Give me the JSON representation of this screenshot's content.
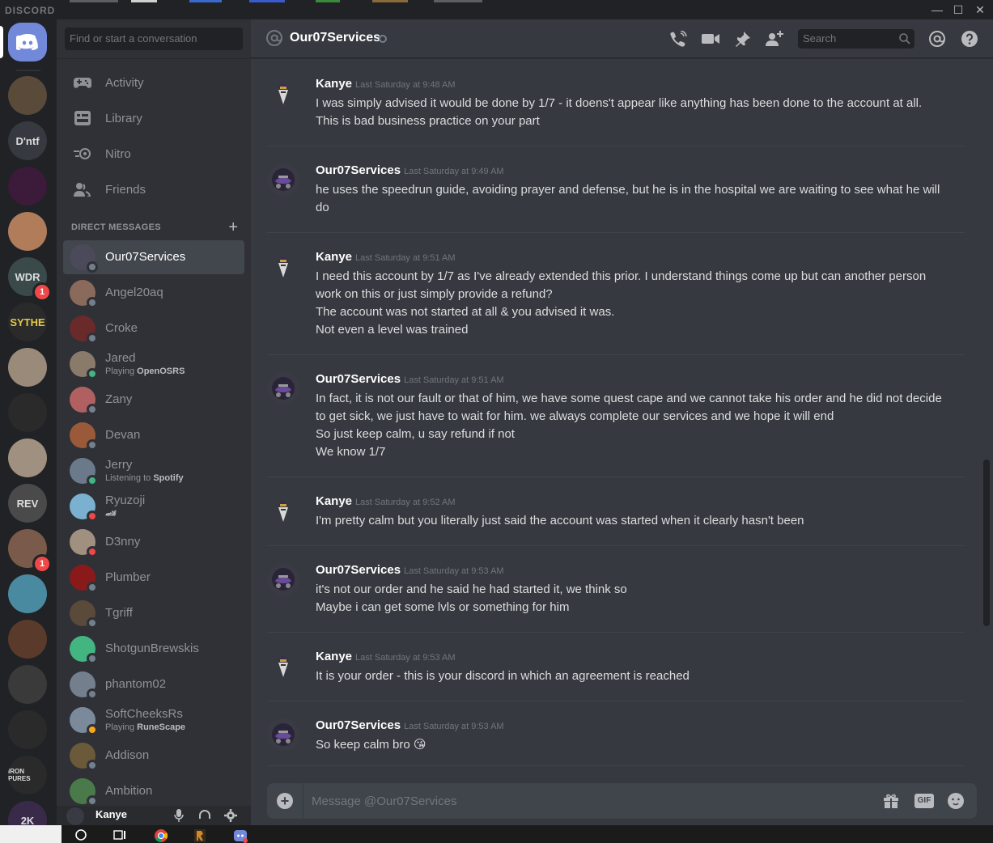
{
  "window": {
    "brand": "DISCORD",
    "minimize_glyph": "—",
    "maximize_glyph": "☐",
    "close_glyph": "✕"
  },
  "servers": {
    "items": [
      {
        "label": "",
        "kind": "home"
      },
      {
        "label": "",
        "color": "#5a4a3a"
      },
      {
        "label": "D'ntf",
        "color": "#36393f"
      },
      {
        "label": "",
        "color": "#3b1a3a"
      },
      {
        "label": "",
        "color": "#b07c5a"
      },
      {
        "label": "WDR",
        "color": "#3a4a4a",
        "badge": "1"
      },
      {
        "label": "SYTHE",
        "color": "#2a2a2a"
      },
      {
        "label": "",
        "color": "#9a8a7a"
      },
      {
        "label": "",
        "color": "#2a2a2a"
      },
      {
        "label": "",
        "color": "#a09080"
      },
      {
        "label": "REV",
        "color": "#4a4a4a"
      },
      {
        "label": "",
        "color": "#7a5a4a",
        "badge": "1"
      },
      {
        "label": "",
        "color": "#4a8aa0"
      },
      {
        "label": "",
        "color": "#5a3a2a"
      },
      {
        "label": "",
        "color": "#3a3a3a"
      },
      {
        "label": "",
        "color": "#2a2a2a"
      },
      {
        "label": "IRON PURES",
        "color": "#2a2a2a"
      },
      {
        "label": "2K",
        "color": "#3a2a4a"
      }
    ]
  },
  "sidebar": {
    "search_placeholder": "Find or start a conversation",
    "nav": [
      {
        "label": "Activity",
        "icon": "gamepad-icon"
      },
      {
        "label": "Library",
        "icon": "library-icon"
      },
      {
        "label": "Nitro",
        "icon": "nitro-icon"
      },
      {
        "label": "Friends",
        "icon": "friends-icon"
      }
    ],
    "dm_header": "DIRECT MESSAGES",
    "dm_add": "+",
    "dms": [
      {
        "name": "Our07Services",
        "status": "offline",
        "color": "#4a4a5a",
        "active": true
      },
      {
        "name": "Angel20aq",
        "status": "offline",
        "color": "#8a6a5a"
      },
      {
        "name": "Croke",
        "status": "offline",
        "color": "#6a2a2a"
      },
      {
        "name": "Jared",
        "status": "online",
        "color": "#8a7a6a",
        "activity_prefix": "Playing ",
        "activity": "OpenOSRS"
      },
      {
        "name": "Zany",
        "status": "offline",
        "color": "#b06060"
      },
      {
        "name": "Devan",
        "status": "offline",
        "color": "#9a5a3a"
      },
      {
        "name": "Jerry",
        "status": "online",
        "color": "#6a7a8a",
        "activity_prefix": "Listening to ",
        "activity": "Spotify"
      },
      {
        "name": "Ryuzoji",
        "status": "dnd",
        "color": "#7ab0d0",
        "activity_prefix": "",
        "activity": "🏎"
      },
      {
        "name": "D3nny",
        "status": "dnd",
        "color": "#a09080"
      },
      {
        "name": "Plumber",
        "status": "offline",
        "color": "#8a1a1a"
      },
      {
        "name": "Tgriff",
        "status": "offline",
        "color": "#5a4a3a"
      },
      {
        "name": "ShotgunBrewskis",
        "status": "offline",
        "color": "#43b581"
      },
      {
        "name": "phantom02",
        "status": "offline",
        "color": "#747f8d"
      },
      {
        "name": "SoftCheeksRs",
        "status": "idle",
        "color": "#7a8a9a",
        "activity_prefix": "Playing ",
        "activity": "RuneScape"
      },
      {
        "name": "Addison",
        "status": "offline",
        "color": "#6a5a3a"
      },
      {
        "name": "Ambition",
        "status": "offline",
        "color": "#4a7a4a"
      }
    ],
    "user": {
      "name": "Kanye"
    }
  },
  "chat": {
    "channel_name": "Our07Services",
    "search_placeholder": "Search",
    "composer_placeholder": "Message @Our07Services",
    "gif_label": "GIF",
    "messages": [
      {
        "author": "Kanye",
        "timestamp": "Last Saturday at 9:48 AM",
        "avatar": "kanye",
        "lines": [
          "I was simply advised it would be done by 1/7 - it doens't appear like anything has been done to the account at all.",
          "This is bad business practice on your part"
        ]
      },
      {
        "author": "Our07Services",
        "timestamp": "Last Saturday at 9:49 AM",
        "avatar": "our07",
        "lines": [
          "he uses the speedrun guide, avoiding prayer and defense, but he is in the hospital we are waiting to see what he will do"
        ]
      },
      {
        "author": "Kanye",
        "timestamp": "Last Saturday at 9:51 AM",
        "avatar": "kanye",
        "lines": [
          "I need this account by 1/7 as I've already extended this prior. I understand things come up but can another person work on this or just simply provide a refund?",
          "The account was not started at all & you advised it was.",
          "Not even a level was trained"
        ]
      },
      {
        "author": "Our07Services",
        "timestamp": "Last Saturday at 9:51 AM",
        "avatar": "our07",
        "lines": [
          "In fact, it is not our fault or that of him, we have some quest cape and we cannot take his order and he did not decide to get sick, we just have to wait for him. we always complete our services and we hope it will end",
          "So just keep calm, u say refund if not",
          "We know 1/7"
        ]
      },
      {
        "author": "Kanye",
        "timestamp": "Last Saturday at 9:52 AM",
        "avatar": "kanye",
        "lines": [
          "I'm pretty calm but you literally just said the account was started when it clearly hasn't been"
        ]
      },
      {
        "author": "Our07Services",
        "timestamp": "Last Saturday at 9:53 AM",
        "avatar": "our07",
        "lines": [
          "it's not our order and he said he had started it, we think so",
          "Maybe i can get some lvls or something for him"
        ]
      },
      {
        "author": "Kanye",
        "timestamp": "Last Saturday at 9:53 AM",
        "avatar": "kanye",
        "lines": [
          "It is your order - this is your discord in which an agreement is reached"
        ]
      },
      {
        "author": "Our07Services",
        "timestamp": "Last Saturday at 9:53 AM",
        "avatar": "our07",
        "lines": [
          "So keep calm bro 😘"
        ]
      }
    ]
  },
  "colors": {
    "blurple": "#7289da",
    "online": "#43b581",
    "idle": "#faa61a",
    "dnd": "#f04747",
    "offline": "#747f8d"
  }
}
